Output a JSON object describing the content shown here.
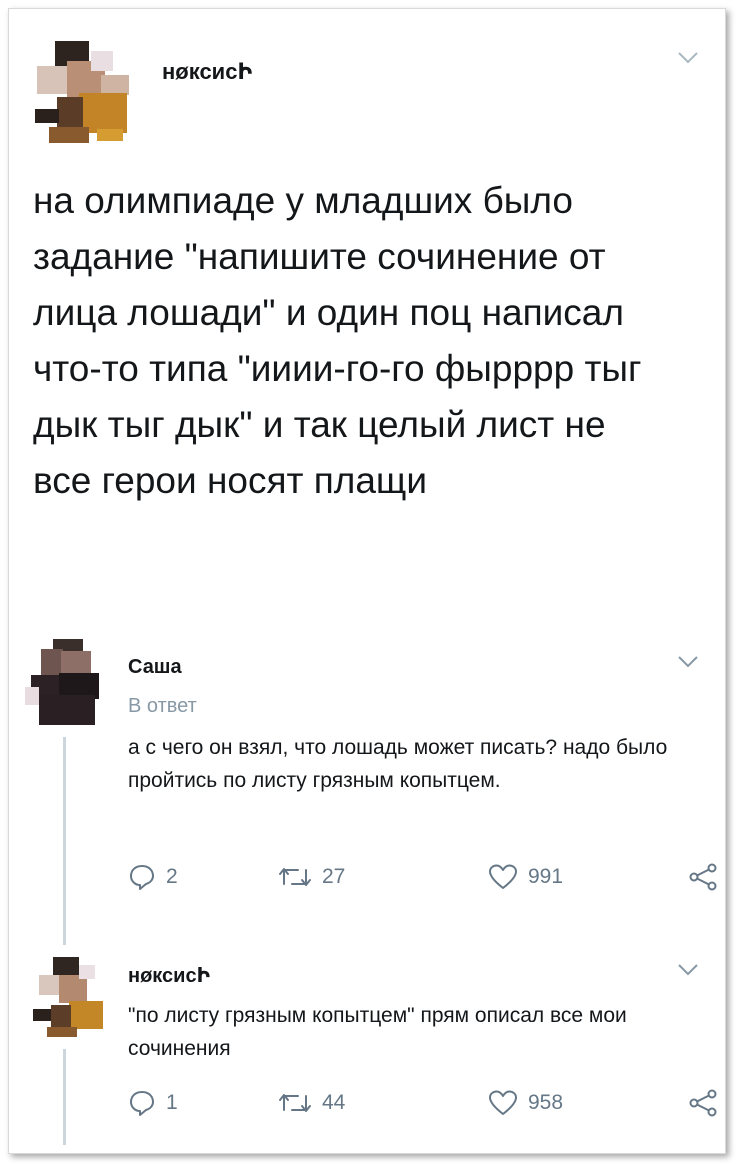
{
  "main_tweet": {
    "author": "нøксисԻ",
    "text": "на олимпиаде у младших было задание \"напишите сочинение от лица лошади\" и один поц написал что-то типа \"ииии-го-го фырррр тыг дык тыг дык\" и так целый лист не все герои носят плащи"
  },
  "replies": [
    {
      "author": "Саша",
      "meta": "В ответ",
      "text": "а с чего он взял, что лошадь может писать? надо было пройтись по листу грязным копытцем.",
      "counts": {
        "replies": "2",
        "retweets": "27",
        "likes": "991"
      }
    },
    {
      "author": "нøксисԻ",
      "text": "\"по листу грязным копытцем\" прям описал все мои сочинения",
      "counts": {
        "replies": "1",
        "retweets": "44",
        "likes": "958"
      }
    }
  ],
  "icons": {
    "chevron": "chevron-down-icon",
    "reply": "reply-icon",
    "retweet": "retweet-icon",
    "like": "heart-icon",
    "share": "share-icon"
  },
  "colors": {
    "text": "#14171a",
    "muted": "#8899a6",
    "thread_line": "#ccd6dd"
  }
}
